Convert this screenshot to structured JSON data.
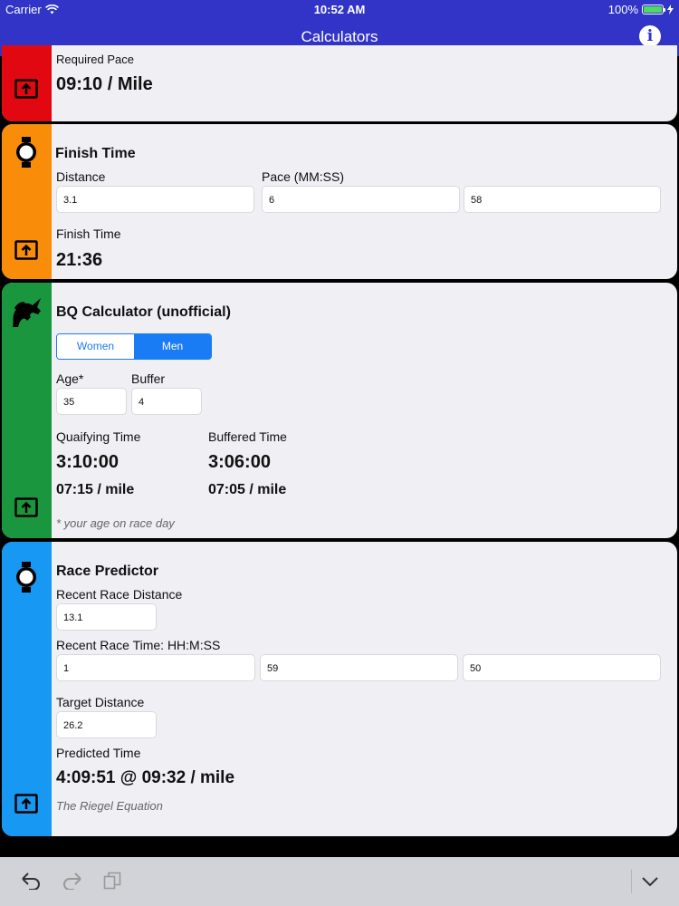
{
  "status_bar": {
    "carrier": "Carrier",
    "time": "10:52 AM",
    "battery": "100%"
  },
  "nav": {
    "title": "Calculators"
  },
  "colors": {
    "red": "#e20812",
    "orange": "#f98d0a",
    "green": "#1a963e",
    "blue": "#1698f3",
    "nav": "#3134c7"
  },
  "pace_card": {
    "label": "Required Pace",
    "value": "09:10 / Mile"
  },
  "finish_card": {
    "title": "Finish Time",
    "distance_label": "Distance",
    "pace_label": "Pace (MM:SS)",
    "distance": "3.1",
    "pace_min": "6",
    "pace_sec": "58",
    "result_label": "Finish Time",
    "result": "21:36"
  },
  "bq_card": {
    "title": "BQ Calculator (unofficial)",
    "segments": [
      "Women",
      "Men"
    ],
    "selected_segment": "Men",
    "age_label": "Age*",
    "buffer_label": "Buffer",
    "age": "35",
    "buffer": "4",
    "qualifying_label": "Quaifying Time",
    "qualifying_time": "3:10:00",
    "qualifying_pace": "07:15 / mile",
    "buffered_label": "Buffered Time",
    "buffered_time": "3:06:00",
    "buffered_pace": "07:05 / mile",
    "footnote": "* your age on race day"
  },
  "race_card": {
    "title": "Race Predictor",
    "recent_distance_label": "Recent Race Distance",
    "recent_distance": "13.1",
    "recent_time_label": "Recent Race Time: HH:M:SS",
    "recent_h": "1",
    "recent_m": "59",
    "recent_s": "50",
    "target_label": "Target Distance",
    "target": "26.2",
    "predicted_label": "Predicted Time",
    "predicted": "4:09:51 @ 09:32 / mile",
    "method": "The Riegel Equation"
  },
  "icons": {
    "pace_card": "share-icon",
    "finish_card": [
      "stopwatch-icon",
      "share-icon"
    ],
    "bq_card": [
      "unicorn-icon",
      "share-icon"
    ],
    "race_card": [
      "stopwatch-icon",
      "share-icon"
    ],
    "toolbar": [
      "undo-icon",
      "redo-icon",
      "paste-icon",
      "chevron-down-icon"
    ]
  }
}
